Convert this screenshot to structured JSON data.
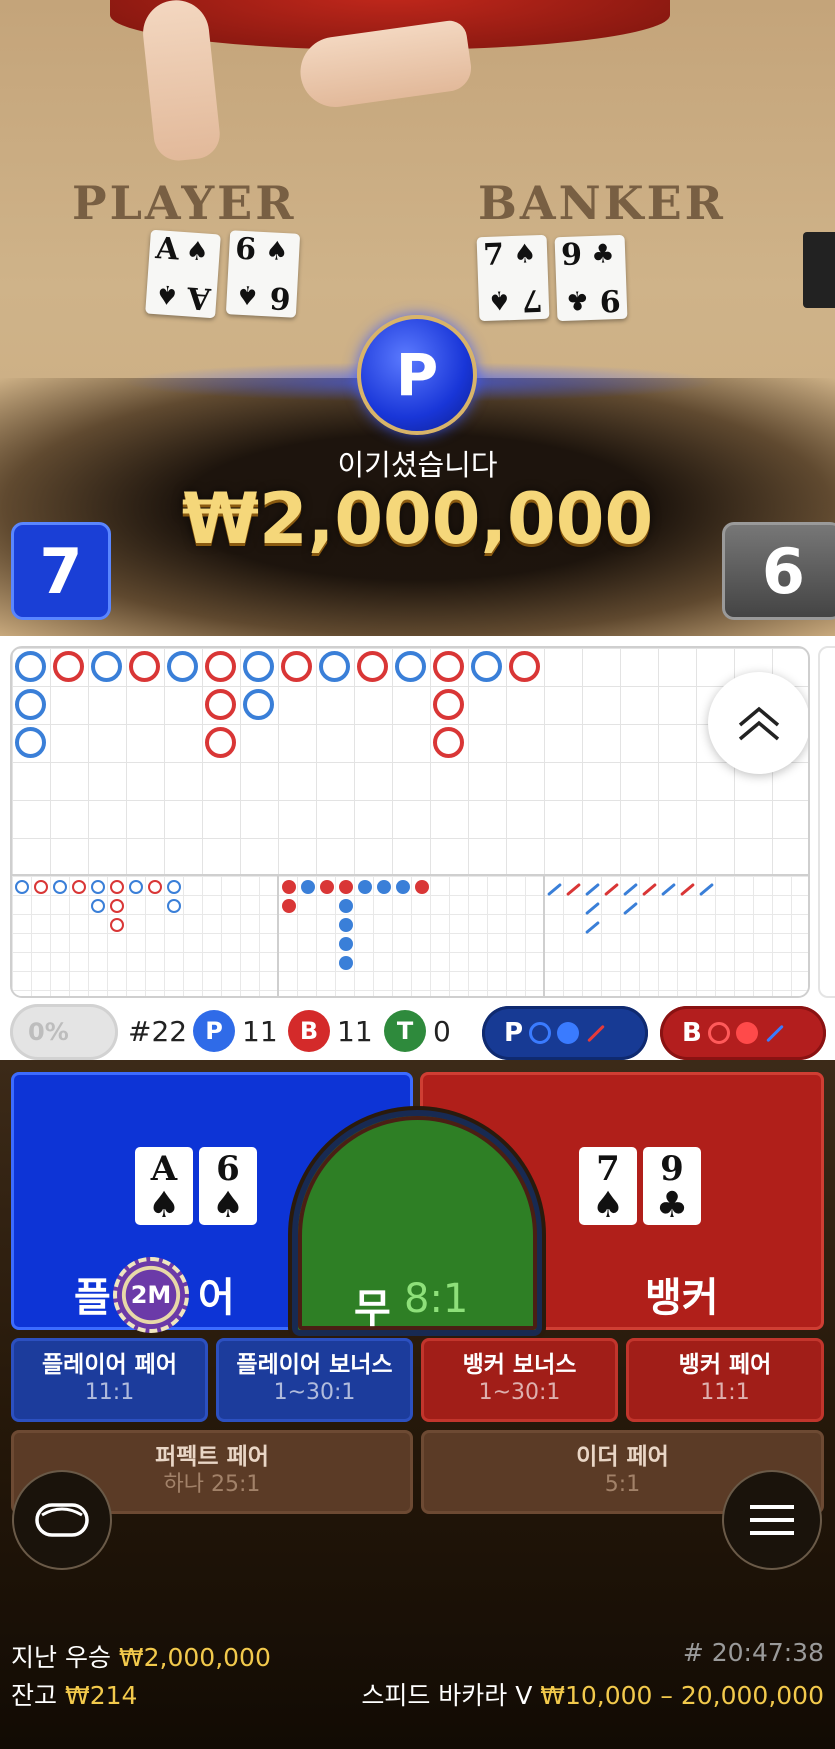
{
  "video": {
    "table_player_label": "PLAYER",
    "table_banker_label": "BANKER",
    "player_cards": [
      {
        "rank": "A",
        "suit": "♠"
      },
      {
        "rank": "6",
        "suit": "♠"
      }
    ],
    "banker_cards": [
      {
        "rank": "7",
        "suit": "♠"
      },
      {
        "rank": "9",
        "suit": "♣"
      }
    ],
    "winner_badge": "P",
    "win_message": "이기셨습니다",
    "win_amount": "₩2,000,000",
    "player_score": "7",
    "banker_score": "6"
  },
  "stats": {
    "percent": "0%",
    "round": "#22",
    "p_label": "P",
    "p_count": "11",
    "b_label": "B",
    "b_count": "11",
    "t_label": "T",
    "t_count": "0",
    "predict_p": "P",
    "predict_b": "B"
  },
  "bets": {
    "player_label_left": "플",
    "player_label_right": "어",
    "player_cards": [
      {
        "rank": "A",
        "suit": "♠"
      },
      {
        "rank": "6",
        "suit": "♠"
      }
    ],
    "banker_cards": [
      {
        "rank": "7",
        "suit": "♠"
      },
      {
        "rank": "9",
        "suit": "♣"
      }
    ],
    "tie_label": "무",
    "tie_odds": "8:1",
    "banker_label": "뱅커",
    "chip_value": "2M",
    "player_pair": {
      "label": "플레이어 페어",
      "odds": "11:1"
    },
    "player_bonus": {
      "label": "플레이어 보너스",
      "odds": "1~30:1"
    },
    "banker_bonus": {
      "label": "뱅커 보너스",
      "odds": "1~30:1"
    },
    "banker_pair": {
      "label": "뱅커 페어",
      "odds": "11:1"
    },
    "perfect_pair": {
      "label": "퍼펙트 페어",
      "odds": "하나 25:1"
    },
    "either_pair": {
      "label": "이더 페어",
      "odds": "5:1"
    }
  },
  "footer": {
    "last_win_label": "지난 우승",
    "last_win_amount": "₩2,000,000",
    "balance_label": "잔고",
    "balance_amount": "₩214",
    "round_time": "# 20:47:38",
    "game_name": "스피드 바카라 V",
    "limits": "₩10,000 – 20,000,000"
  },
  "colors": {
    "player_blue": "#0d34d6",
    "banker_red": "#b01f1a",
    "tie_green": "#2e7f25",
    "gold": "#f2c94c"
  }
}
